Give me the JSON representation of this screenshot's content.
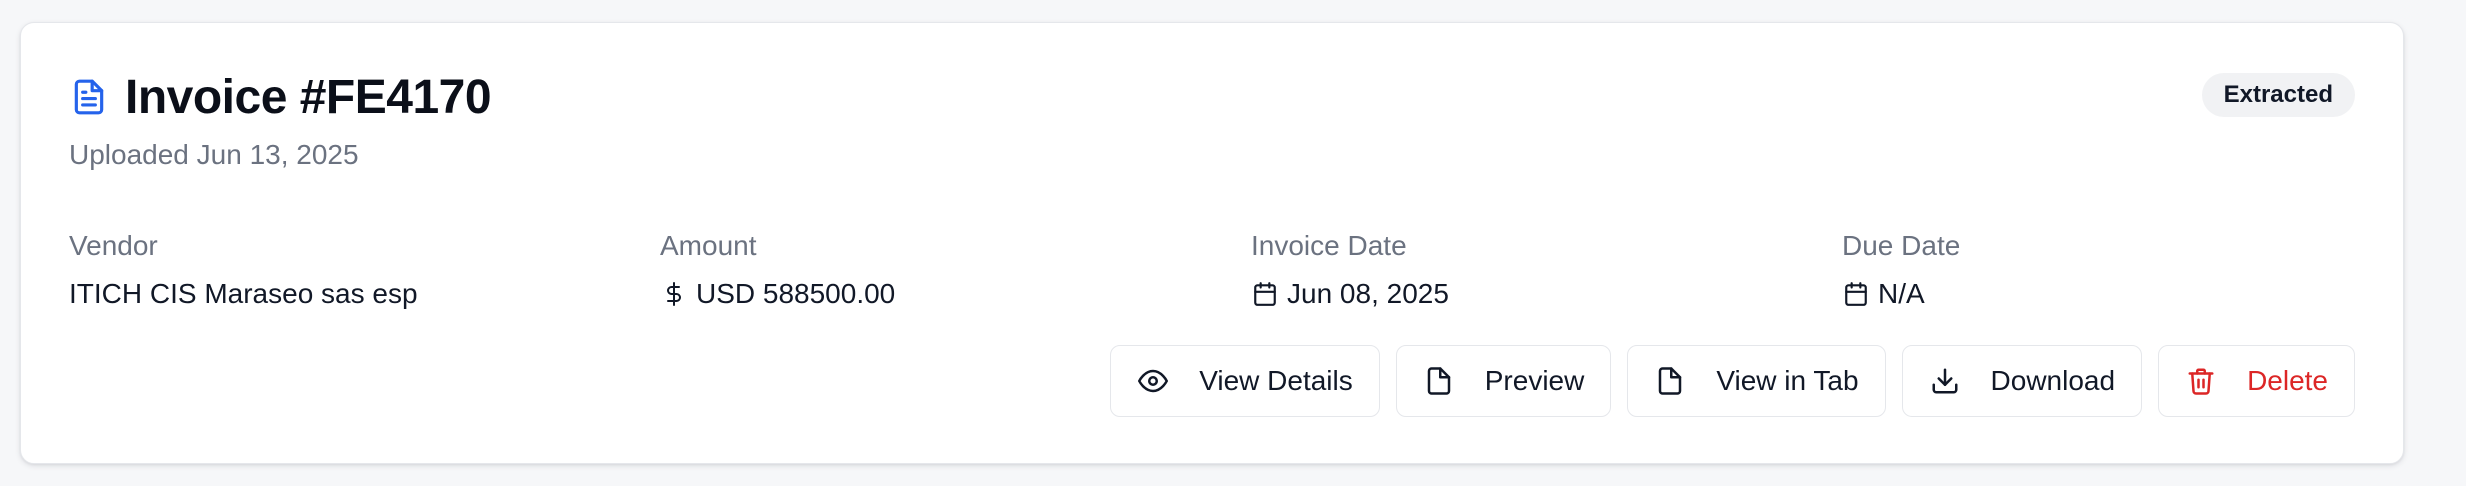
{
  "invoice": {
    "title": "Invoice #FE4170",
    "uploaded": "Uploaded Jun 13, 2025",
    "status": "Extracted"
  },
  "fields": {
    "vendor": {
      "label": "Vendor",
      "value": "ITICH CIS Maraseo sas esp"
    },
    "amount": {
      "label": "Amount",
      "value": "USD 588500.00",
      "icon": "dollar-icon"
    },
    "invoice_date": {
      "label": "Invoice Date",
      "value": "Jun 08, 2025",
      "icon": "calendar-icon"
    },
    "due_date": {
      "label": "Due Date",
      "value": "N/A",
      "icon": "calendar-icon"
    }
  },
  "actions": {
    "view_details": {
      "label": "View Details",
      "icon": "eye-icon"
    },
    "preview": {
      "label": "Preview",
      "icon": "file-icon"
    },
    "view_in_tab": {
      "label": "View in Tab",
      "icon": "file-icon"
    },
    "download": {
      "label": "Download",
      "icon": "download-icon"
    },
    "delete": {
      "label": "Delete",
      "icon": "trash-icon"
    }
  },
  "colors": {
    "accent": "#2563eb",
    "danger": "#dc2626",
    "muted_text": "#6b7280",
    "badge_bg": "#f1f2f4"
  }
}
